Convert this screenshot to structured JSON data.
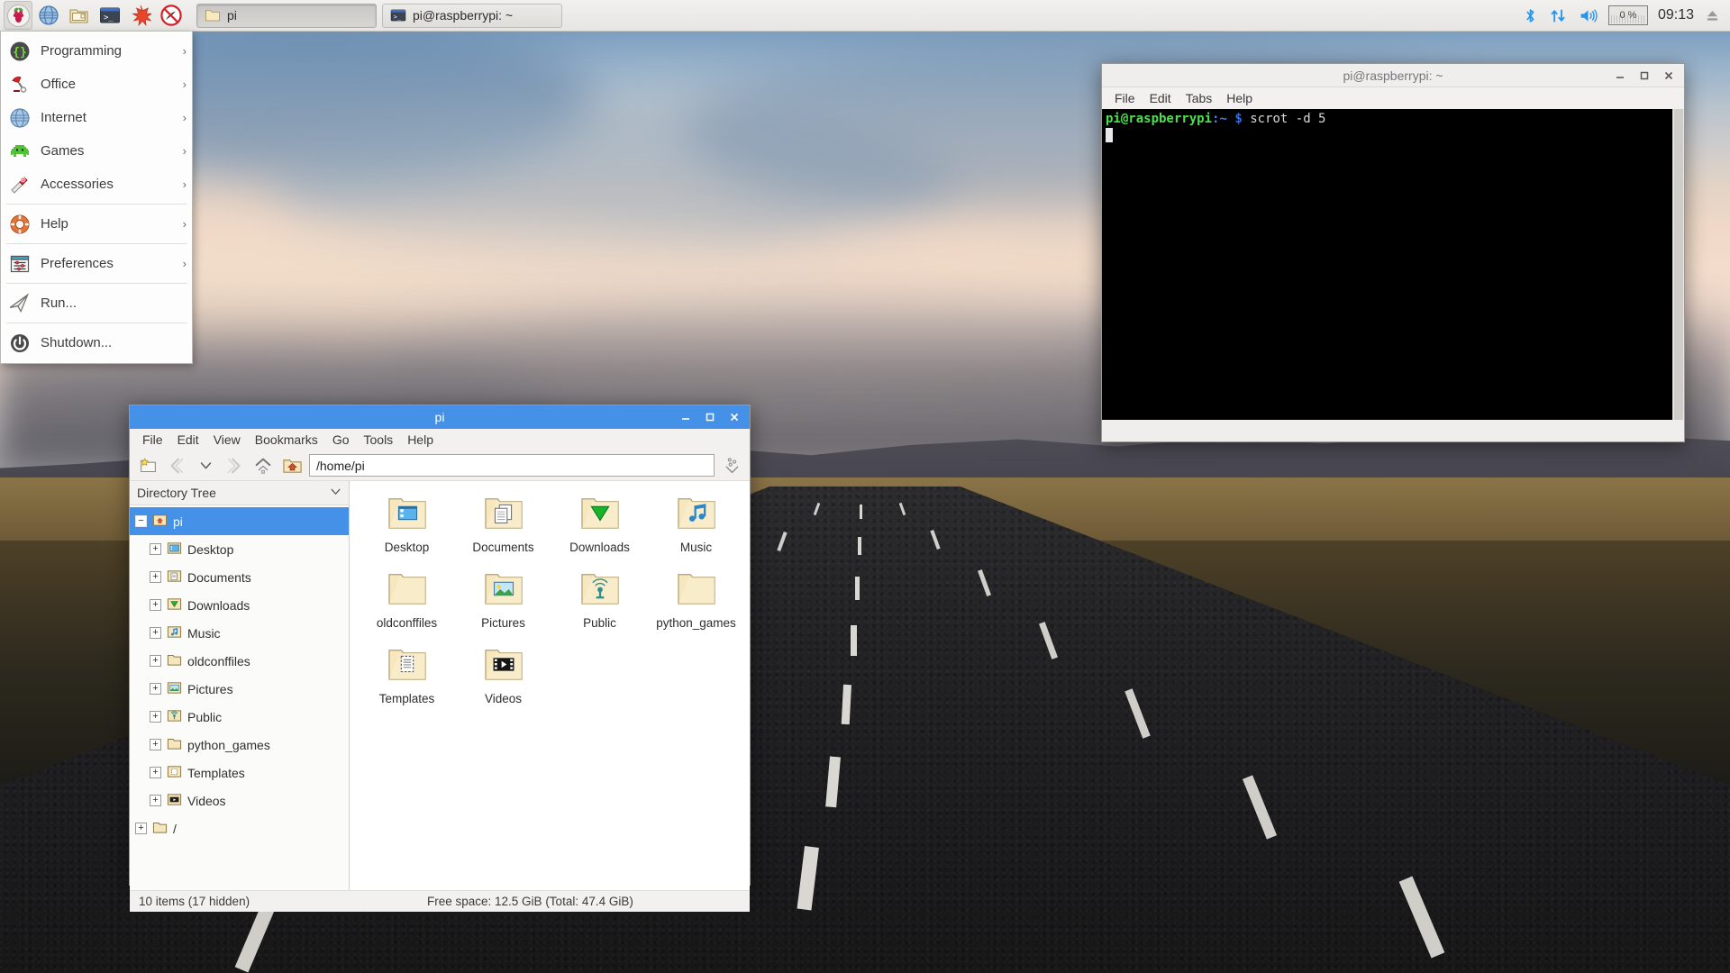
{
  "taskbar": {
    "launchers": [
      {
        "name": "raspberry-menu-icon",
        "title": "Menu"
      },
      {
        "name": "web-browser-icon",
        "title": "Web Browser"
      },
      {
        "name": "file-manager-icon",
        "title": "File Manager"
      },
      {
        "name": "terminal-icon",
        "title": "Terminal"
      },
      {
        "name": "mathematica-icon",
        "title": "Mathematica"
      },
      {
        "name": "wolfram-icon",
        "title": "Wolfram"
      }
    ],
    "windows": [
      {
        "label": "pi",
        "icon": "folder-icon",
        "active": true
      },
      {
        "label": "pi@raspberrypi: ~",
        "icon": "terminal-icon",
        "active": false
      }
    ],
    "tray": {
      "bluetooth": "bluetooth-icon",
      "network": "network-updown-icon",
      "volume": "volume-icon",
      "cpu_percent": "0 %",
      "clock": "09:13",
      "eject": "eject-icon"
    }
  },
  "startmenu": {
    "items": [
      {
        "label": "Programming",
        "icon": "code-braces-icon",
        "arrow": "›",
        "sep_after": false
      },
      {
        "label": "Office",
        "icon": "desk-lamp-icon",
        "arrow": "›",
        "sep_after": false
      },
      {
        "label": "Internet",
        "icon": "globe-icon",
        "arrow": "›",
        "sep_after": false
      },
      {
        "label": "Games",
        "icon": "space-invader-icon",
        "arrow": "›",
        "sep_after": false
      },
      {
        "label": "Accessories",
        "icon": "swiss-knife-icon",
        "arrow": "›",
        "sep_after": true
      },
      {
        "label": "Help",
        "icon": "lifebuoy-icon",
        "arrow": "›",
        "sep_after": true
      },
      {
        "label": "Preferences",
        "icon": "sliders-icon",
        "arrow": "›",
        "sep_after": true
      },
      {
        "label": "Run...",
        "icon": "paper-plane-icon",
        "arrow": "",
        "sep_after": true
      },
      {
        "label": "Shutdown...",
        "icon": "power-icon",
        "arrow": "",
        "sep_after": false
      }
    ]
  },
  "filemanager": {
    "title": "pi",
    "menus": [
      "File",
      "Edit",
      "View",
      "Bookmarks",
      "Go",
      "Tools",
      "Help"
    ],
    "path": "/home/pi",
    "sidebar_title": "Directory Tree",
    "tree": [
      {
        "label": "pi",
        "icon": "home-folder-icon",
        "expander": "−",
        "selected": true,
        "indent": false
      },
      {
        "label": "Desktop",
        "icon": "desktop-folder-icon",
        "expander": "+",
        "selected": false,
        "indent": true
      },
      {
        "label": "Documents",
        "icon": "documents-folder-icon",
        "expander": "+",
        "selected": false,
        "indent": true
      },
      {
        "label": "Downloads",
        "icon": "downloads-folder-icon",
        "expander": "+",
        "selected": false,
        "indent": true
      },
      {
        "label": "Music",
        "icon": "music-folder-icon",
        "expander": "+",
        "selected": false,
        "indent": true
      },
      {
        "label": "oldconffiles",
        "icon": "plain-folder-icon",
        "expander": "+",
        "selected": false,
        "indent": true
      },
      {
        "label": "Pictures",
        "icon": "pictures-folder-icon",
        "expander": "+",
        "selected": false,
        "indent": true
      },
      {
        "label": "Public",
        "icon": "public-folder-icon",
        "expander": "+",
        "selected": false,
        "indent": true
      },
      {
        "label": "python_games",
        "icon": "plain-folder-icon",
        "expander": "+",
        "selected": false,
        "indent": true
      },
      {
        "label": "Templates",
        "icon": "templates-folder-icon",
        "expander": "+",
        "selected": false,
        "indent": true
      },
      {
        "label": "Videos",
        "icon": "videos-folder-icon",
        "expander": "+",
        "selected": false,
        "indent": true
      },
      {
        "label": "/",
        "icon": "plain-folder-icon",
        "expander": "+",
        "selected": false,
        "indent": false
      }
    ],
    "files": [
      {
        "label": "Desktop",
        "icon": "desktop-folder-icon"
      },
      {
        "label": "Documents",
        "icon": "documents-folder-icon"
      },
      {
        "label": "Downloads",
        "icon": "downloads-folder-icon"
      },
      {
        "label": "Music",
        "icon": "music-folder-icon"
      },
      {
        "label": "oldconffiles",
        "icon": "plain-folder-icon"
      },
      {
        "label": "Pictures",
        "icon": "pictures-folder-icon"
      },
      {
        "label": "Public",
        "icon": "public-folder-icon"
      },
      {
        "label": "python_games",
        "icon": "plain-folder-icon"
      },
      {
        "label": "Templates",
        "icon": "templates-folder-icon"
      },
      {
        "label": "Videos",
        "icon": "videos-folder-icon"
      }
    ],
    "status_items": "10 items (17 hidden)",
    "status_free": "Free space: 12.5 GiB (Total: 47.4 GiB)"
  },
  "terminal": {
    "title": "pi@raspberrypi: ~",
    "menus": [
      "File",
      "Edit",
      "Tabs",
      "Help"
    ],
    "prompt_user": "pi@raspberrypi",
    "prompt_colon": ":",
    "prompt_path": "~",
    "prompt_symbol": "$",
    "command": "scrot -d 5"
  },
  "colors": {
    "accent_blue": "#4591e8",
    "taskbar_bg": "#eceae7",
    "tray_blue": "#2196f3",
    "terminal_bg": "#000000"
  }
}
